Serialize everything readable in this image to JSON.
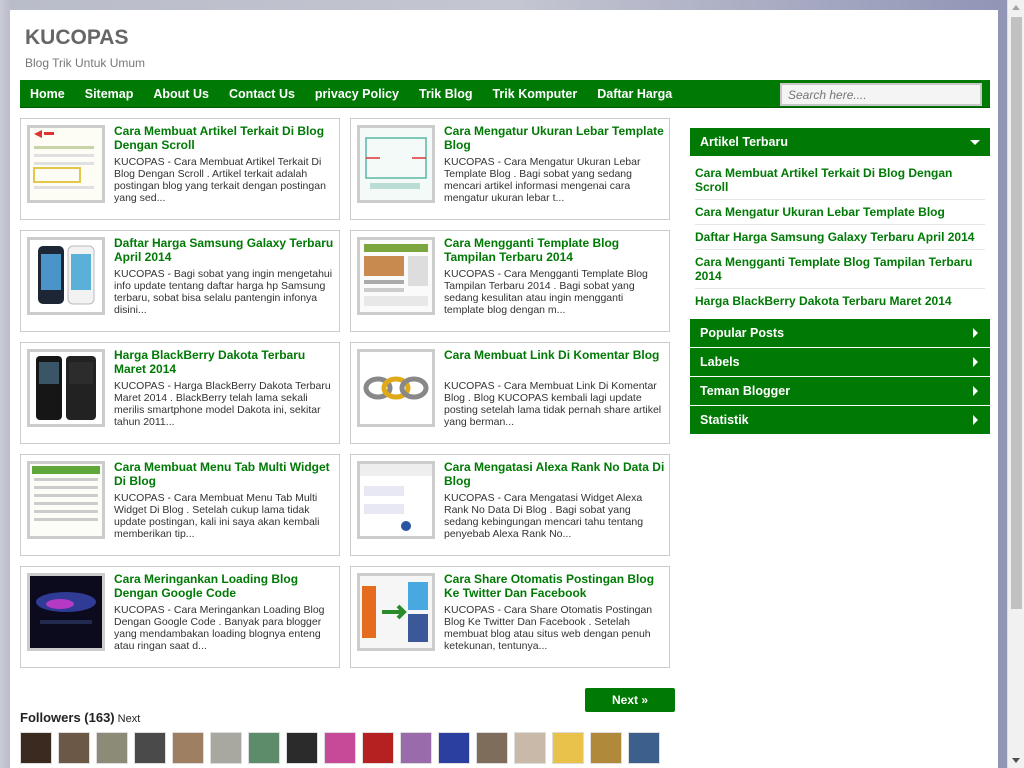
{
  "site": {
    "title": "KUCOPAS",
    "description": "Blog Trik Untuk Umum"
  },
  "nav": [
    "Home",
    "Sitemap",
    "About Us",
    "Contact Us",
    "privacy Policy",
    "Trik Blog",
    "Trik Komputer",
    "Daftar Harga"
  ],
  "search": {
    "placeholder": "Search here...."
  },
  "posts": [
    {
      "title": "Cara Membuat Artikel Terkait Di Blog Dengan Scroll",
      "snippet": "KUCOPAS - Cara Membuat Artikel Terkait Di Blog Dengan Scroll . Artikel terkait adalah postingan blog yang terkait dengan postingan yang sed..."
    },
    {
      "title": "Cara Mengatur Ukuran Lebar Template Blog",
      "snippet": "KUCOPAS - Cara Mengatur Ukuran Lebar Template Blog . Bagi sobat yang sedang mencari artikel informasi mengenai cara mengatur ukuran lebar t..."
    },
    {
      "title": "Daftar Harga Samsung Galaxy Terbaru April 2014",
      "snippet": "KUCOPAS - Bagi sobat yang ingin mengetahui info update tentang daftar harga hp Samsung terbaru, sobat bisa selalu pantengin infonya disini..."
    },
    {
      "title": "Cara Mengganti Template Blog Tampilan Terbaru 2014",
      "snippet": "KUCOPAS - Cara Mengganti Template Blog Tampilan Terbaru 2014 . Bagi sobat yang sedang kesulitan atau ingin mengganti template blog dengan m..."
    },
    {
      "title": "Harga BlackBerry Dakota Terbaru Maret 2014",
      "snippet": "KUCOPAS - Harga BlackBerry Dakota Terbaru Maret 2014 . BlackBerry telah lama sekali merilis smartphone model Dakota ini, sekitar tahun 2011..."
    },
    {
      "title": "Cara Membuat Link Di Komentar Blog",
      "snippet": "KUCOPAS - Cara Membuat Link Di Komentar Blog . Blog KUCOPAS kembali lagi update posting setelah lama tidak pernah share artikel yang berman..."
    },
    {
      "title": "Cara Membuat Menu Tab Multi Widget Di Blog",
      "snippet": "KUCOPAS - Cara Membuat Menu Tab Multi Widget Di Blog . Setelah cukup lama tidak update postingan, kali ini saya akan kembali memberikan tip..."
    },
    {
      "title": "Cara Mengatasi Alexa Rank No Data Di Blog",
      "snippet": "KUCOPAS - Cara Mengatasi Widget Alexa Rank No Data Di Blog . Bagi sobat yang sedang kebingungan mencari tahu tentang penyebab Alexa Rank No..."
    },
    {
      "title": "Cara Meringankan Loading Blog Dengan Google Code",
      "snippet": "KUCOPAS - Cara Meringankan Loading Blog Dengan Google Code . Banyak para blogger yang mendambakan loading blognya enteng atau ringan saat d..."
    },
    {
      "title": "Cara Share Otomatis Postingan Blog Ke Twitter Dan Facebook",
      "snippet": "KUCOPAS - Cara Share Otomatis Postingan Blog Ke Twitter Dan Facebook . Setelah membuat blog atau situs web dengan penuh ketekunan, tentunya..."
    }
  ],
  "pagination": {
    "next": "Next »"
  },
  "followers": {
    "label": "Followers (163)",
    "next": "Next",
    "count": 17
  },
  "sidebar": {
    "recent_title": "Artikel Terbaru",
    "recent": [
      "Cara Membuat Artikel Terkait Di Blog Dengan Scroll",
      "Cara Mengatur Ukuran Lebar Template Blog",
      "Daftar Harga Samsung Galaxy Terbaru April 2014",
      "Cara Mengganti Template Blog Tampilan Terbaru 2014",
      "Harga BlackBerry Dakota Terbaru Maret 2014"
    ],
    "sections": [
      "Popular Posts",
      "Labels",
      "Teman Blogger",
      "Statistik"
    ]
  },
  "colors": {
    "accent": "#007a05",
    "title": "#666666"
  }
}
